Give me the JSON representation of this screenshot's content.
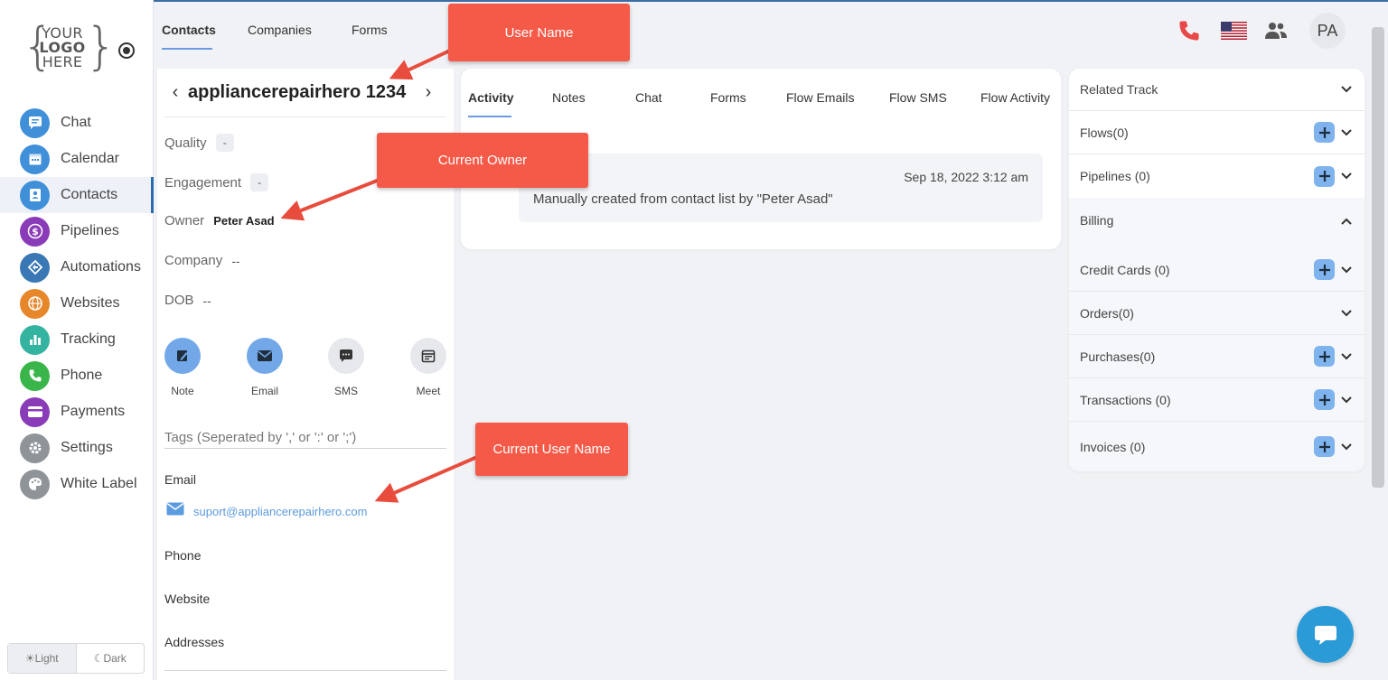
{
  "logo": {
    "line1": "YOUR",
    "line2": "LOGO",
    "line3": "HERE"
  },
  "sidebar": {
    "items": [
      {
        "label": "Chat",
        "icon": "chat-icon",
        "color": "#3f8fd9"
      },
      {
        "label": "Calendar",
        "icon": "calendar-icon",
        "color": "#3f8fd9"
      },
      {
        "label": "Contacts",
        "icon": "contacts-icon",
        "color": "#3f8fd9"
      },
      {
        "label": "Pipelines",
        "icon": "dollar-icon",
        "color": "#8a3bb8"
      },
      {
        "label": "Automations",
        "icon": "automation-icon",
        "color": "#3a77b5"
      },
      {
        "label": "Websites",
        "icon": "globe-icon",
        "color": "#e8862a"
      },
      {
        "label": "Tracking",
        "icon": "bar-chart-icon",
        "color": "#35b3a1"
      },
      {
        "label": "Phone",
        "icon": "phone-icon",
        "color": "#3ab54a"
      },
      {
        "label": "Payments",
        "icon": "card-icon",
        "color": "#8a3bb8"
      },
      {
        "label": "Settings",
        "icon": "gear-icon",
        "color": "#8f9499"
      },
      {
        "label": "White Label",
        "icon": "palette-icon",
        "color": "#8f9499"
      }
    ],
    "active": "Contacts",
    "theme": {
      "light": "Light",
      "dark": "Dark"
    }
  },
  "top_tabs": [
    "Contacts",
    "Companies",
    "Forms"
  ],
  "header": {
    "avatar_initials": "PA"
  },
  "contact": {
    "name": "appliancerepairhero 1234",
    "quality_label": "Quality",
    "quality_value": "-",
    "engagement_label": "Engagement",
    "engagement_value": "-",
    "owner_label": "Owner",
    "owner_value": "Peter Asad",
    "company_label": "Company",
    "company_value": "--",
    "dob_label": "DOB",
    "dob_value": "--",
    "actions": [
      "Note",
      "Email",
      "SMS",
      "Meet"
    ],
    "tags_placeholder": "Tags (Seperated by ',' or ':' or ';')",
    "email_label": "Email",
    "email_value": "suport@appliancerepairhero.com",
    "phone_label": "Phone",
    "website_label": "Website",
    "addresses_label": "Addresses"
  },
  "activity": {
    "tabs": [
      "Activity",
      "Notes",
      "Chat",
      "Forms",
      "Flow Emails",
      "Flow SMS",
      "Flow Activity"
    ],
    "entry_date": "Sep 18, 2022 3:12 am",
    "entry_text": "Manually created from contact list by \"Peter Asad\""
  },
  "right_panel": {
    "related_track": "Related Track",
    "flows": "Flows(0)",
    "pipelines": "Pipelines (0)",
    "billing": "Billing",
    "credit_cards": "Credit Cards (0)",
    "orders": "Orders(0)",
    "purchases": "Purchases(0)",
    "transactions": "Transactions (0)",
    "invoices": "Invoices (0)"
  },
  "callouts": {
    "user_name": "User Name",
    "current_owner": "Current Owner",
    "current_user_name": "Current User Name"
  },
  "colors": {
    "accent": "#2b6cb0",
    "callout": "#f55a48",
    "plus_button": "#7fb3ee",
    "link": "#5b9bdf"
  }
}
